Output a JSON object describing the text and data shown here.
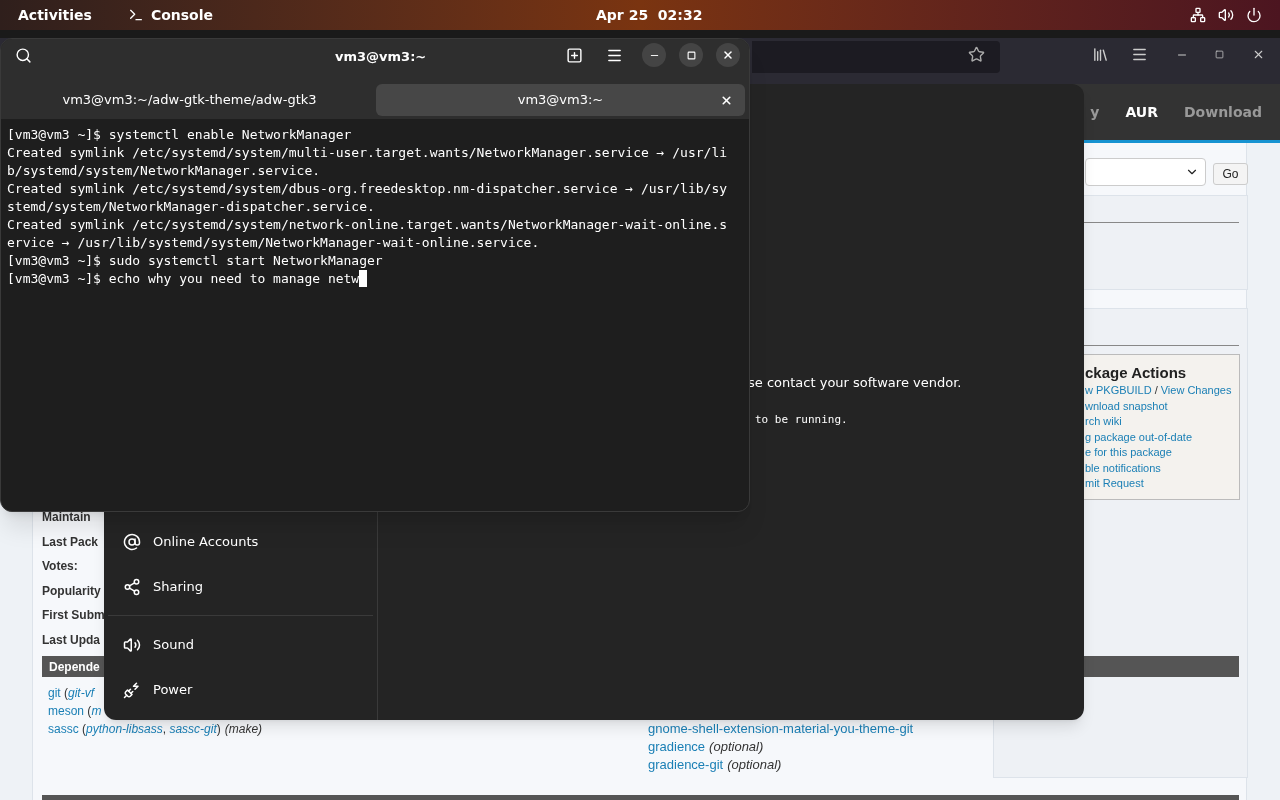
{
  "top_bar": {
    "activities": "Activities",
    "app": "Console",
    "clock": "Apr 25  02:32"
  },
  "browser": {
    "nav": [
      {
        "label": "y",
        "selected": false
      },
      {
        "label": "AUR",
        "selected": true
      },
      {
        "label": "Download",
        "selected": false
      }
    ],
    "search_button": "Go",
    "package_actions": {
      "title": "ckage Actions",
      "links": [
        [
          "w PKGBUILD",
          "View Changes"
        ],
        [
          "wnload snapshot"
        ],
        [
          "rch wiki"
        ],
        [
          "g package out-of-date"
        ],
        [
          "e for this package"
        ],
        [
          "ble notifications"
        ],
        [
          "mit Request"
        ]
      ],
      "separator": "/"
    },
    "details_labels": [
      "Maintain",
      "Last Pack",
      "Votes:",
      "Popularity",
      "First Subm",
      "Last Upda"
    ],
    "dependencies": {
      "title": "Depende",
      "left": [
        [
          {
            "text": "git",
            "kind": "link"
          },
          {
            "text": " (",
            "kind": "plain"
          },
          {
            "text": "git-vf",
            "kind": "alt"
          }
        ],
        [
          {
            "text": "meson",
            "kind": "link"
          },
          {
            "text": " (",
            "kind": "plain"
          },
          {
            "text": "m",
            "kind": "alt"
          }
        ],
        [
          {
            "text": "sassc",
            "kind": "link"
          },
          {
            "text": " (",
            "kind": "plain"
          },
          {
            "text": "python-libsass",
            "kind": "alt"
          },
          {
            "text": ", ",
            "kind": "plain"
          },
          {
            "text": "sassc-git",
            "kind": "alt"
          },
          {
            "text": ")",
            "kind": "plain"
          },
          {
            "text": "(make)",
            "kind": "note"
          }
        ]
      ],
      "right": [
        [
          {
            "text": "gnome-shell-extension-material-you-theme-git",
            "kind": "link"
          }
        ],
        [
          {
            "text": "gradience",
            "kind": "link"
          },
          {
            "text": "(optional)",
            "kind": "note"
          }
        ],
        [
          {
            "text": "gradience-git",
            "kind": "link"
          },
          {
            "text": "(optional)",
            "kind": "note"
          }
        ]
      ]
    }
  },
  "settings": {
    "sidebar_groups": [
      [
        {
          "label": "Online Accounts"
        },
        {
          "label": "Sharing"
        }
      ],
      [
        {
          "label": "Sound"
        },
        {
          "label": "Power"
        }
      ]
    ],
    "message": "se contact your software vendor.",
    "terminal_fragment": "to be running."
  },
  "terminal": {
    "title": "vm3@vm3:~",
    "tabs": [
      {
        "label": "vm3@vm3:~/adw-gtk-theme/adw-gtk3",
        "selected": false
      },
      {
        "label": "vm3@vm3:~",
        "selected": true
      }
    ],
    "lines": [
      "[vm3@vm3 ~]$ systemctl enable NetworkManager",
      "Created symlink /etc/systemd/system/multi-user.target.wants/NetworkManager.service → /usr/li",
      "b/systemd/system/NetworkManager.service.",
      "Created symlink /etc/systemd/system/dbus-org.freedesktop.nm-dispatcher.service → /usr/lib/sy",
      "stemd/system/NetworkManager-dispatcher.service.",
      "Created symlink /etc/systemd/system/network-online.target.wants/NetworkManager-wait-online.s",
      "ervice → /usr/lib/systemd/system/NetworkManager-wait-online.service.",
      "[vm3@vm3 ~]$ sudo systemctl start NetworkManager",
      "[vm3@vm3 ~]$ echo why you need to manage netw"
    ]
  }
}
